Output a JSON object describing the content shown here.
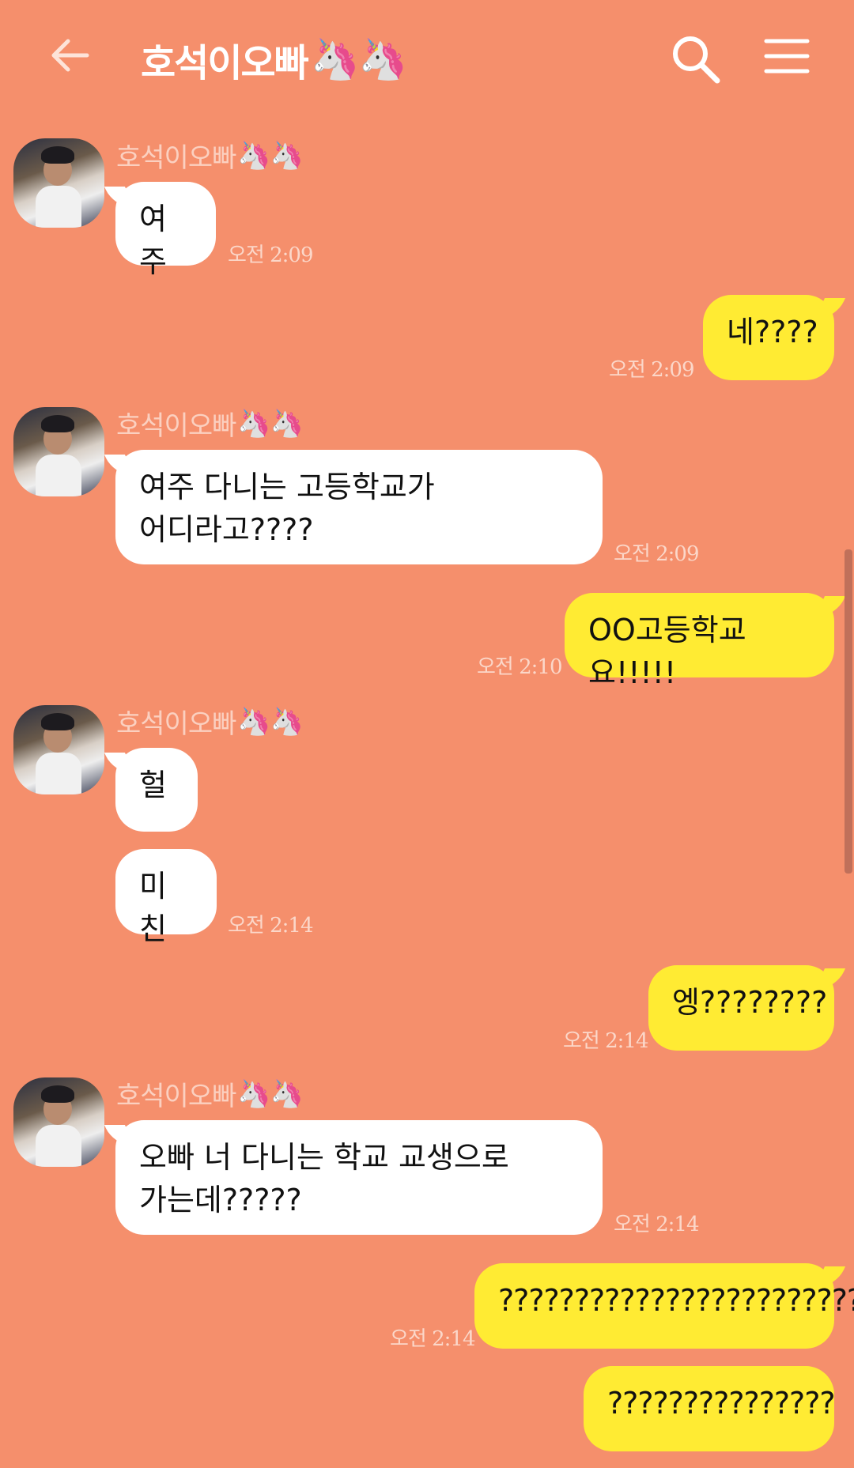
{
  "header": {
    "title": "호석이오빠",
    "title_emoji": "🦄🦄"
  },
  "sender": {
    "name": "호석이오빠",
    "emoji": "🦄🦄"
  },
  "messages": [
    {
      "text": "여주",
      "time": "오전 2:09"
    },
    {
      "text": "네????",
      "time": "오전 2:09"
    },
    {
      "text": "여주 다니는 고등학교가\n어디라고????",
      "time": "오전 2:09"
    },
    {
      "text": "OO고등학교요!!!!!",
      "time": "오전 2:10"
    },
    {
      "text": "헐",
      "time": ""
    },
    {
      "text": "미친",
      "time": "오전 2:14"
    },
    {
      "text": "엥????????",
      "time": "오전 2:14"
    },
    {
      "text": "오빠 너 다니는 학교 교생으로\n가는데?????",
      "time": "오전 2:14"
    },
    {
      "text": "????????????????????????",
      "time": "오전 2:14"
    },
    {
      "text": "???????????????",
      "time": ""
    }
  ],
  "colors": {
    "background": "#F58F6C",
    "incoming_bubble": "#FFFFFF",
    "outgoing_bubble": "#FFEB33"
  },
  "icons": {
    "back": "arrow-left-icon",
    "search": "search-icon",
    "menu": "hamburger-menu-icon"
  }
}
